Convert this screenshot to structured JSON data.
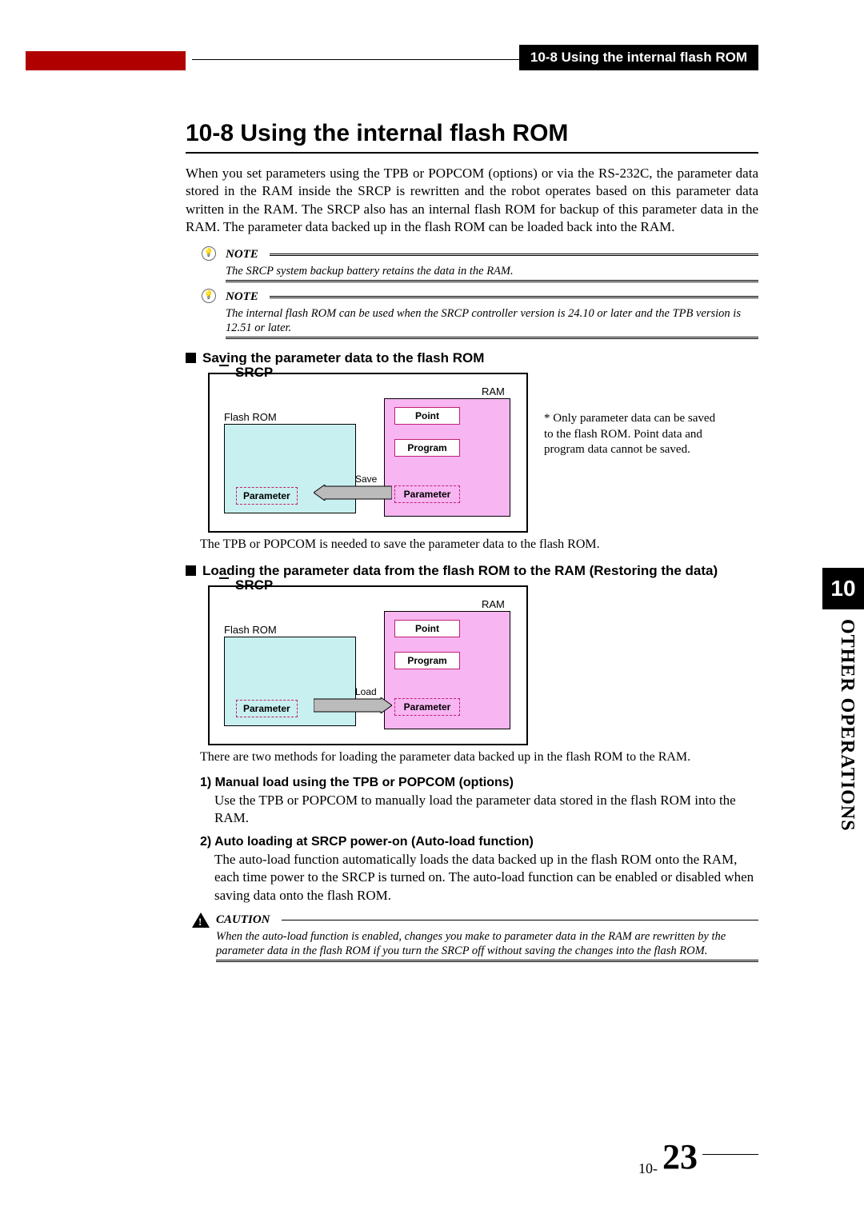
{
  "header": {
    "tab": "10-8 Using the internal flash ROM"
  },
  "h1": "10-8  Using the internal flash ROM",
  "intro": "When you set parameters using the TPB or POPCOM (options) or via the RS-232C, the parameter data stored in the RAM inside the SRCP is rewritten and the robot operates based on this parameter data written in the RAM. The SRCP also has an internal flash ROM for backup of this parameter data in the RAM. The parameter data backed up in the flash ROM can be loaded back into the RAM.",
  "notes": [
    {
      "label": "NOTE",
      "text": "The SRCP system backup battery retains the data in the RAM."
    },
    {
      "label": "NOTE",
      "text": "The internal flash ROM can be used when the SRCP controller version is 24.10 or later and the TPB version is 12.51 or later."
    }
  ],
  "section1": {
    "heading": "Saving the parameter data to the flash ROM",
    "srcp": "SRCP",
    "flash_label": "Flash ROM",
    "ram_label": "RAM",
    "point": "Point",
    "program": "Program",
    "parameter": "Parameter",
    "arrow": "Save",
    "sidenote": "* Only parameter data can be saved to the flash ROM. Point data and program data cannot be saved.",
    "caption": "The TPB or POPCOM is needed to save the parameter data to the flash ROM."
  },
  "section2": {
    "heading": "Loading the parameter data from the flash ROM to the RAM (Restoring the data)",
    "srcp": "SRCP",
    "flash_label": "Flash ROM",
    "ram_label": "RAM",
    "point": "Point",
    "program": "Program",
    "parameter": "Parameter",
    "arrow": "Load",
    "caption": "There are two methods for loading the parameter data backed up in the flash ROM to the RAM."
  },
  "methods": [
    {
      "head": "1) Manual load using the TPB or POPCOM (options)",
      "body": "Use the TPB or POPCOM to manually load the parameter data stored in the flash ROM into the RAM."
    },
    {
      "head": "2) Auto loading at SRCP power-on (Auto-load function)",
      "body": "The auto-load function automatically loads the data backed up in the flash ROM onto the RAM, each time power to the SRCP is turned on. The auto-load function can be enabled or disabled when saving data onto the flash ROM."
    }
  ],
  "caution": {
    "label": "CAUTION",
    "text": "When the auto-load function is enabled, changes you make to parameter data in the RAM are rewritten by the parameter data in the flash ROM if you turn the SRCP off without saving the changes into the flash ROM."
  },
  "chapter": {
    "num": "10",
    "title": "OTHER OPERATIONS"
  },
  "footer": {
    "prefix": "10-",
    "page": "23"
  }
}
